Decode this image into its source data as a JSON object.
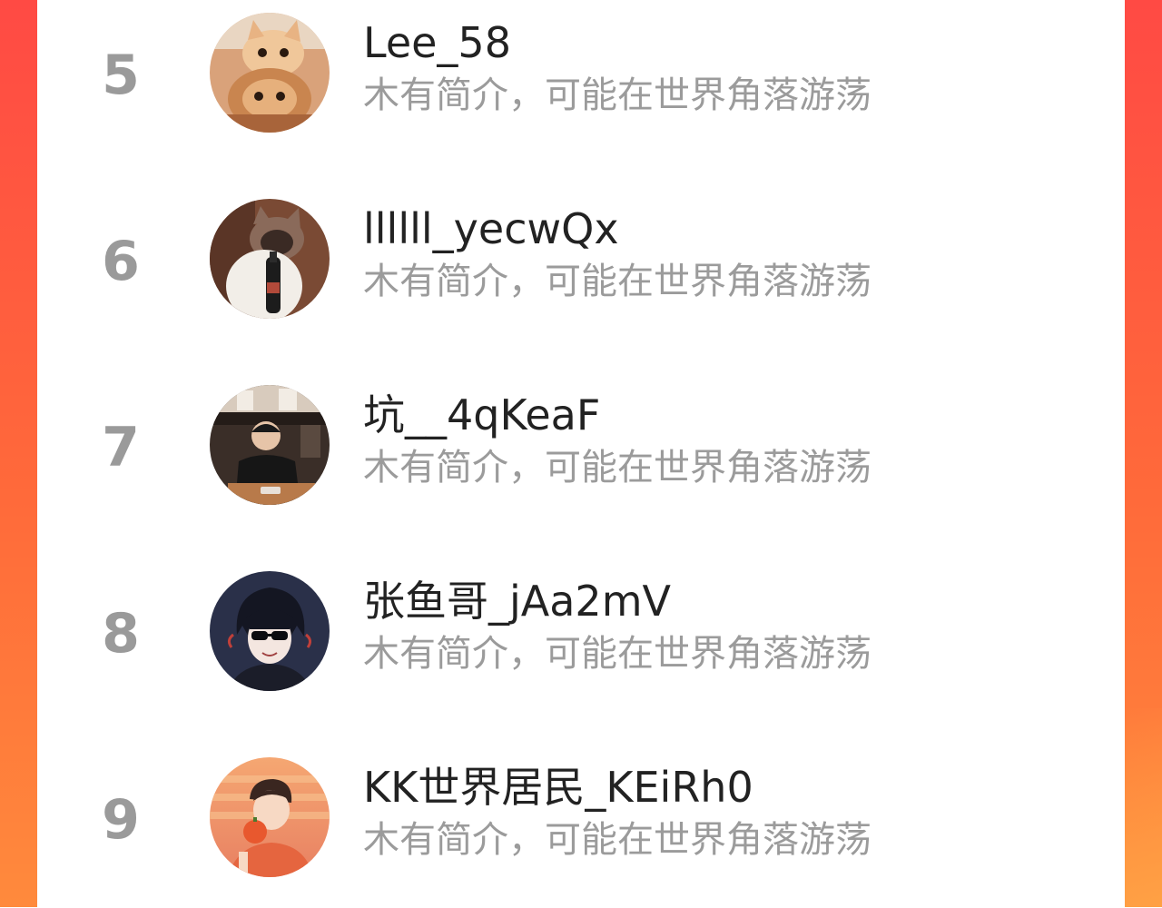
{
  "ranking_list": {
    "items": [
      {
        "rank": "5",
        "name": "Lee_58",
        "bio": "木有简介，可能在世界角落游荡",
        "avatar": "cat-avatar"
      },
      {
        "rank": "6",
        "name": "llllll_yecwQx",
        "bio": "木有简介，可能在世界角落游荡",
        "avatar": "cat-avatar"
      },
      {
        "rank": "7",
        "name": "坑__4qKeaF",
        "bio": "木有简介，可能在世界角落游荡",
        "avatar": "person-photo-avatar"
      },
      {
        "rank": "8",
        "name": "张鱼哥_jAa2mV",
        "bio": "木有简介，可能在世界角落游荡",
        "avatar": "anime-avatar"
      },
      {
        "rank": "9",
        "name": "KK世界居民_KEiRh0",
        "bio": "木有简介，可能在世界角落游荡",
        "avatar": "illustration-avatar"
      }
    ]
  },
  "colors": {
    "background_gradient_top": "#ff4a44",
    "background_gradient_bottom": "#ff8a3c",
    "card": "#ffffff",
    "rank_text": "#9a9a9a",
    "name_text": "#222222",
    "bio_text": "#9b9b9b"
  }
}
